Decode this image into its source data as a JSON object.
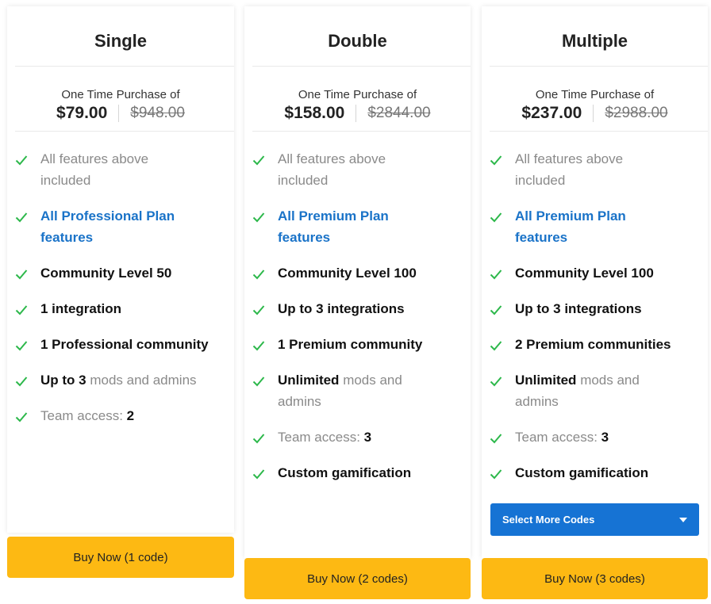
{
  "colors": {
    "check": "#2db84b",
    "buy_button": "#fdb913",
    "select_button": "#1673d4",
    "link_blue": "#1a73c8"
  },
  "plans": [
    {
      "title": "Single",
      "price_label": "One Time Purchase of",
      "price": "$79.00",
      "old_price": "$948.00",
      "features": [
        {
          "muted": "All features above",
          "muted2": "included"
        },
        {
          "blue": "All Professional Plan",
          "blue2": "features"
        },
        {
          "bold": "Community Level 50"
        },
        {
          "bold": "1 integration"
        },
        {
          "bold": "1 Professional community"
        },
        {
          "bold": "Up to 3",
          "muted": "mods and admins"
        },
        {
          "muted": "Team access:",
          "bold": "2"
        }
      ],
      "buy_label": "Buy Now (1 code)"
    },
    {
      "title": "Double",
      "price_label": "One Time Purchase of",
      "price": "$158.00",
      "old_price": "$2844.00",
      "features": [
        {
          "muted": "All features above",
          "muted2": "included"
        },
        {
          "blue": "All Premium Plan",
          "blue2": "features"
        },
        {
          "bold": "Community Level 100"
        },
        {
          "bold": "Up to 3 integrations"
        },
        {
          "bold": "1 Premium community"
        },
        {
          "bold": "Unlimited",
          "muted": "mods and",
          "muted2": "admins"
        },
        {
          "muted": "Team access:",
          "bold": "3"
        },
        {
          "bold": "Custom gamification"
        }
      ],
      "buy_label": "Buy Now (2 codes)"
    },
    {
      "title": "Multiple",
      "price_label": "One Time Purchase of",
      "price": "$237.00",
      "old_price": "$2988.00",
      "features": [
        {
          "muted": "All features above",
          "muted2": "included"
        },
        {
          "blue": "All Premium Plan",
          "blue2": "features"
        },
        {
          "bold": "Community Level 100"
        },
        {
          "bold": "Up to 3 integrations"
        },
        {
          "bold": "2 Premium communities"
        },
        {
          "bold": "Unlimited",
          "muted": "mods and",
          "muted2": "admins"
        },
        {
          "muted": "Team access:",
          "bold": "3"
        },
        {
          "bold": "Custom gamification"
        }
      ],
      "select_label": "Select More Codes",
      "buy_label": "Buy Now (3 codes)"
    }
  ]
}
